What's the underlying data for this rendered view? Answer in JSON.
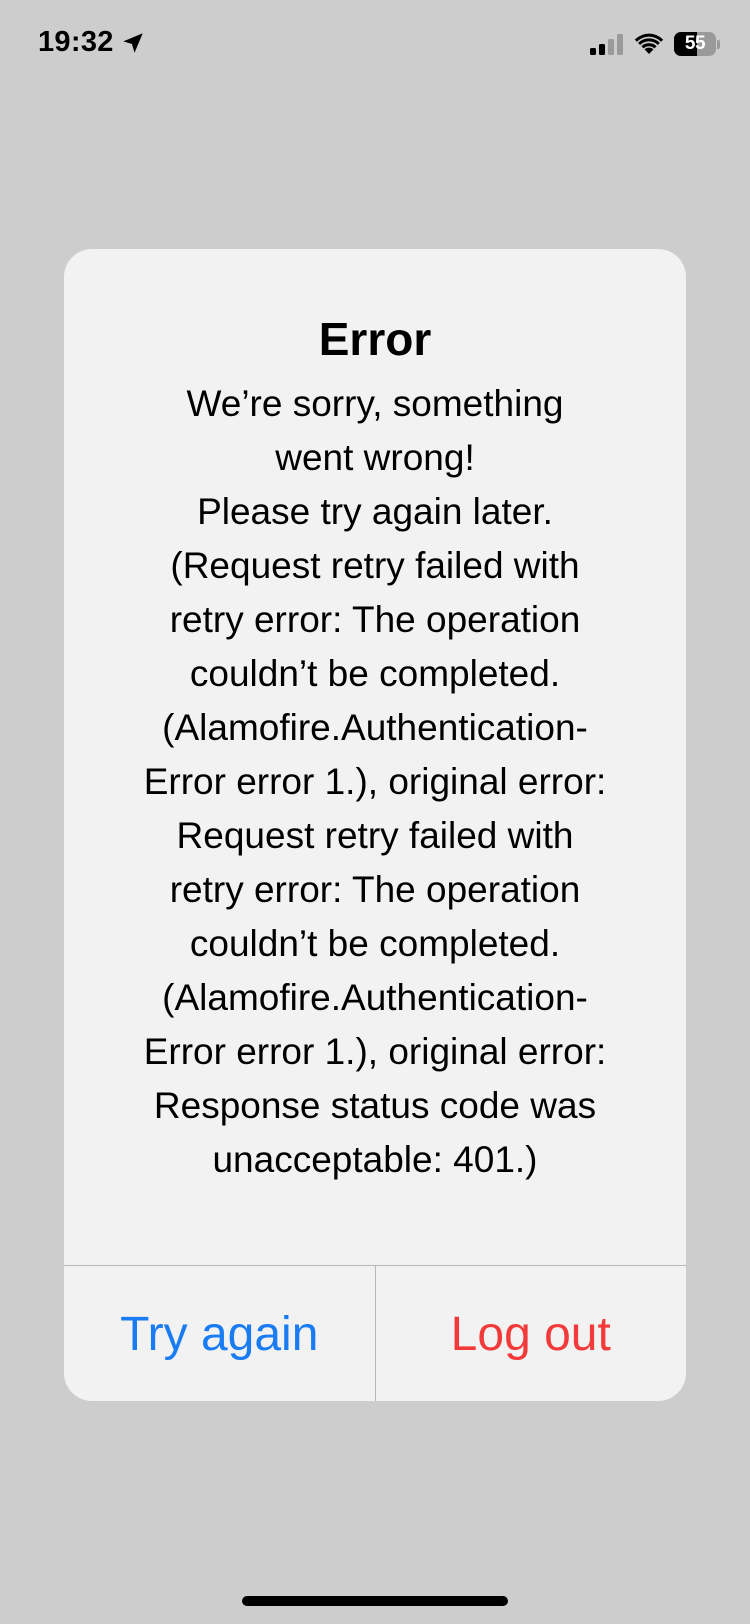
{
  "status_bar": {
    "time": "19:32",
    "location_icon": "location-arrow-icon",
    "signal_icon": "cellular-signal-icon",
    "wifi_icon": "wifi-icon",
    "battery_level": "55",
    "battery_fraction": 0.55
  },
  "alert": {
    "title": "Error",
    "message": "We’re sorry, something\nwent wrong!\nPlease try again later.\n(Request retry failed with\nretry error: The operation\ncouldn’t be completed.\n(Alamofire.Authentication-\nError error 1.), original error:\nRequest retry failed with\nretry error: The operation\ncouldn’t be completed.\n(Alamofire.Authentication-\nError error 1.), original error:\nResponse status code was\nunacceptable: 401.)",
    "actions": {
      "try_again_label": "Try again",
      "log_out_label": "Log out"
    }
  },
  "colors": {
    "background": "#cdcdcd",
    "alert_background": "#f2f2f2",
    "primary_action": "#1a7cf2",
    "destructive_action": "#f23a3a"
  }
}
